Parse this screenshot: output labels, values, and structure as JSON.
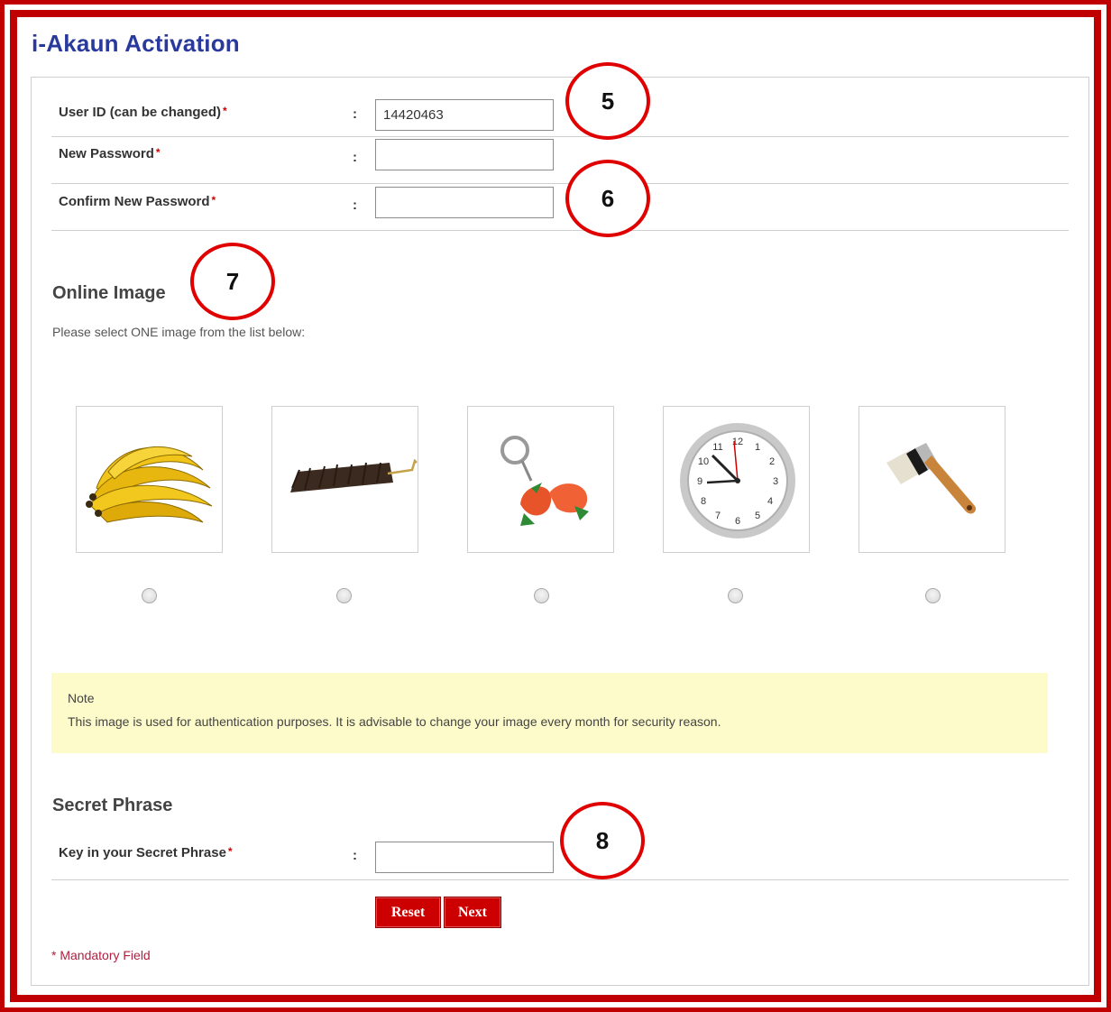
{
  "page": {
    "title": "i-Akaun Activation"
  },
  "account": {
    "user_id_label": "User ID (can be changed)",
    "user_id_value": "14420463",
    "new_password_label": "New Password",
    "confirm_password_label": "Confirm New Password",
    "colon": ":",
    "required_mark": "*"
  },
  "online_image": {
    "title": "Online Image",
    "instruction": "Please select ONE image from the list below:",
    "options": [
      {
        "icon": "banana-image",
        "selected": false
      },
      {
        "icon": "duster-brush-image",
        "selected": false
      },
      {
        "icon": "keychain-image",
        "selected": false
      },
      {
        "icon": "wall-clock-image",
        "selected": false
      },
      {
        "icon": "paint-brush-image",
        "selected": false
      }
    ]
  },
  "note": {
    "title": "Note",
    "text": "This image is used for authentication purposes. It is advisable to change your image every month for security reason."
  },
  "secret_phrase": {
    "title": "Secret Phrase",
    "label": "Key in your Secret Phrase"
  },
  "buttons": {
    "reset": "Reset",
    "next": "Next"
  },
  "footer": {
    "mandatory_mark": "*",
    "mandatory_text": "Mandatory Field"
  },
  "callouts": [
    "5",
    "6",
    "7",
    "8"
  ],
  "colors": {
    "title": "#2a3a9c",
    "frame": "#c00000",
    "button": "#cc0000",
    "note_bg": "#fdfbc9",
    "callout_ring": "#e00000"
  }
}
